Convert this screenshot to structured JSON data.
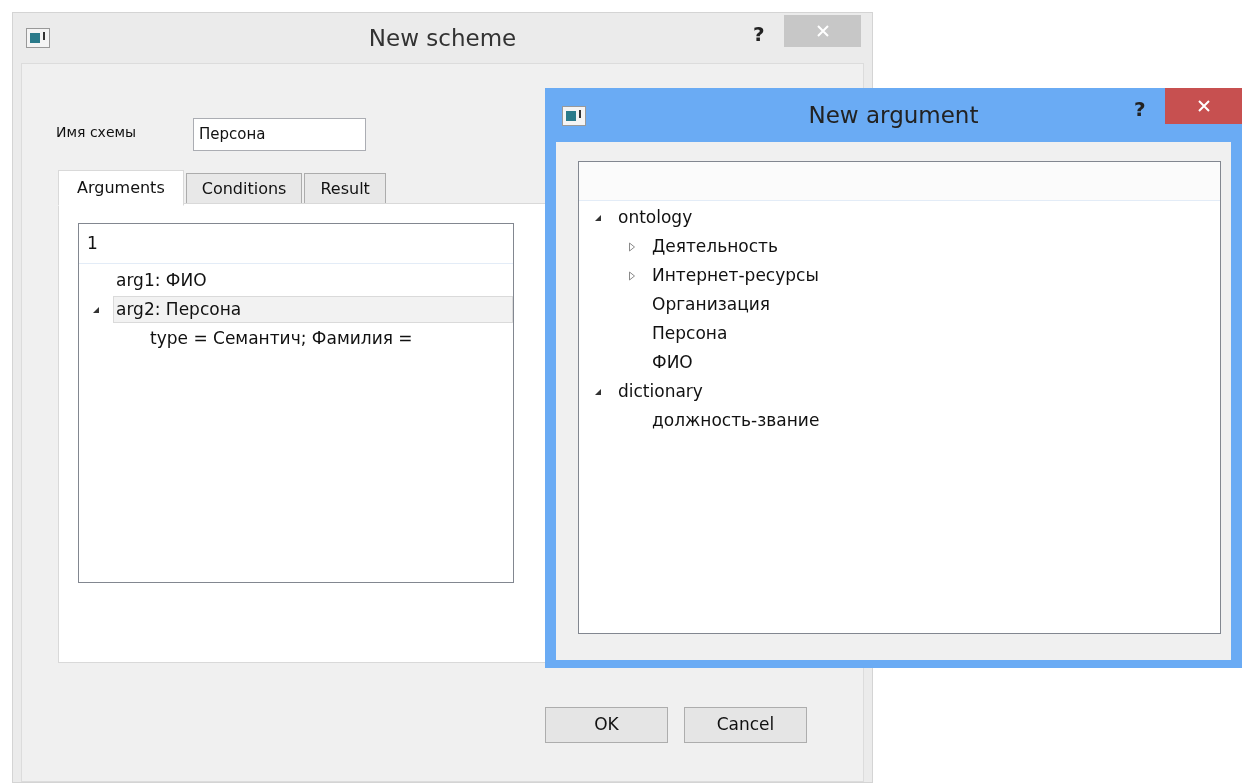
{
  "main_window": {
    "title": "New scheme",
    "active": false,
    "help": "?",
    "name_label": "Имя схемы",
    "name_field": {
      "value": "Персона"
    },
    "tabs": [
      {
        "label": "Arguments",
        "selected": true
      },
      {
        "label": "Conditions",
        "selected": false
      },
      {
        "label": "Result",
        "selected": false
      }
    ],
    "tree": {
      "header": "1",
      "items": [
        {
          "label": "arg1: ФИО",
          "selected": false
        },
        {
          "label": "arg2: Персона",
          "selected": true,
          "expanded": true,
          "children": [
            {
              "label": "type = Семантич; Фамилия =",
              "selected": false
            }
          ]
        }
      ]
    },
    "buttons": [
      "OK",
      "Cancel"
    ]
  },
  "dialog": {
    "title": "New argument",
    "active": true,
    "help": "?",
    "tree": {
      "items": [
        {
          "label": "ontology",
          "selected": false,
          "expanded": true,
          "children": [
            {
              "label": "Деятельность",
              "selected": false,
              "expanded": false
            },
            {
              "label": "Интернет-ресурсы",
              "selected": false,
              "expanded": false
            },
            {
              "label": "Организация",
              "selected": false
            },
            {
              "label": "Персона",
              "selected": false
            },
            {
              "label": "ФИО",
              "selected": false
            }
          ]
        },
        {
          "label": "dictionary",
          "selected": false,
          "expanded": true,
          "children": [
            {
              "label": "должность-звание",
              "selected": false
            }
          ]
        }
      ]
    }
  }
}
